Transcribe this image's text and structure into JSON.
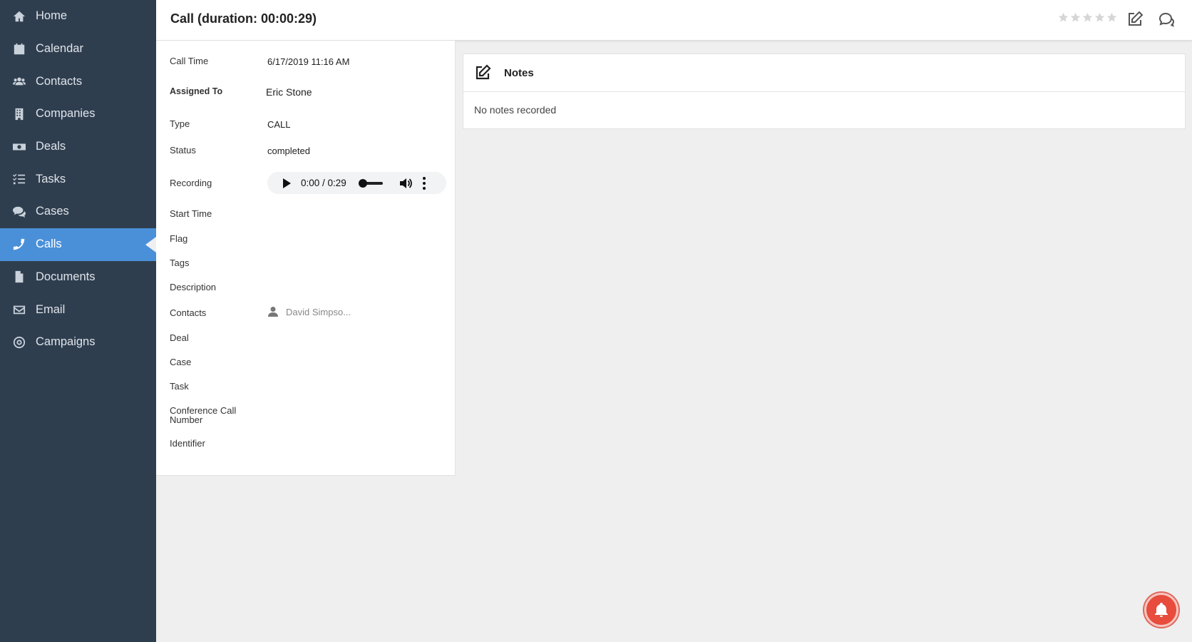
{
  "sidebar": {
    "items": [
      {
        "label": "Home",
        "icon": "home-icon"
      },
      {
        "label": "Calendar",
        "icon": "calendar-icon"
      },
      {
        "label": "Contacts",
        "icon": "users-icon"
      },
      {
        "label": "Companies",
        "icon": "building-icon"
      },
      {
        "label": "Deals",
        "icon": "money-icon"
      },
      {
        "label": "Tasks",
        "icon": "tasks-icon"
      },
      {
        "label": "Cases",
        "icon": "comments-icon"
      },
      {
        "label": "Calls",
        "icon": "phone-icon",
        "active": true
      },
      {
        "label": "Documents",
        "icon": "file-icon"
      },
      {
        "label": "Email",
        "icon": "envelope-icon"
      },
      {
        "label": "Campaigns",
        "icon": "target-icon"
      }
    ]
  },
  "header": {
    "title": "Call (duration: 00:00:29)",
    "rating": 0,
    "rating_max": 5
  },
  "details": {
    "call_time": {
      "label": "Call Time",
      "value": "6/17/2019 11:16 AM"
    },
    "assigned_to": {
      "label": "Assigned To",
      "value": "Eric Stone"
    },
    "type": {
      "label": "Type",
      "value": "CALL"
    },
    "status": {
      "label": "Status",
      "value": "completed"
    },
    "recording": {
      "label": "Recording",
      "time": "0:00 / 0:29"
    },
    "start_time": {
      "label": "Start Time"
    },
    "flag": {
      "label": "Flag"
    },
    "tags": {
      "label": "Tags"
    },
    "description": {
      "label": "Description"
    },
    "contacts": {
      "label": "Contacts",
      "value": "David Simpso..."
    },
    "deal": {
      "label": "Deal"
    },
    "case": {
      "label": "Case"
    },
    "task": {
      "label": "Task"
    },
    "conference_call_number": {
      "label": "Conference Call Number"
    },
    "identifier": {
      "label": "Identifier"
    }
  },
  "notes": {
    "title": "Notes",
    "empty_text": "No notes recorded"
  },
  "colors": {
    "sidebar_bg": "#2f3e4f",
    "active_bg": "#4a90d9",
    "bell_bg": "#e74c3c"
  }
}
